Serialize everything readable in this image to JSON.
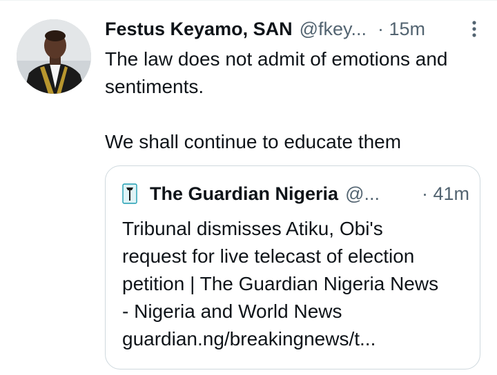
{
  "tweet": {
    "author_name": "Festus Keyamo, SAN",
    "author_handle": "@fkey...",
    "time": "· 15m",
    "text_lines": [
      "The law does not admit of emotions and",
      "sentiments."
    ],
    "text_lines_2": [
      "We shall continue to educate them"
    ]
  },
  "quote": {
    "author_name": "The Guardian Nigeria",
    "author_handle": "@...",
    "time": "· 41m",
    "text_lines": [
      "Tribunal dismisses Atiku, Obi's",
      "request for live telecast of election",
      "petition | The Guardian Nigeria News",
      "- Nigeria and World News",
      "guardian.ng/breakingnews/t..."
    ]
  },
  "colors": {
    "text": "#0f1419",
    "secondary": "#536471",
    "border": "#cfd9de"
  },
  "icons": {
    "more": "more-vertical-icon",
    "guardian_logo": "guardian-logo-icon"
  }
}
